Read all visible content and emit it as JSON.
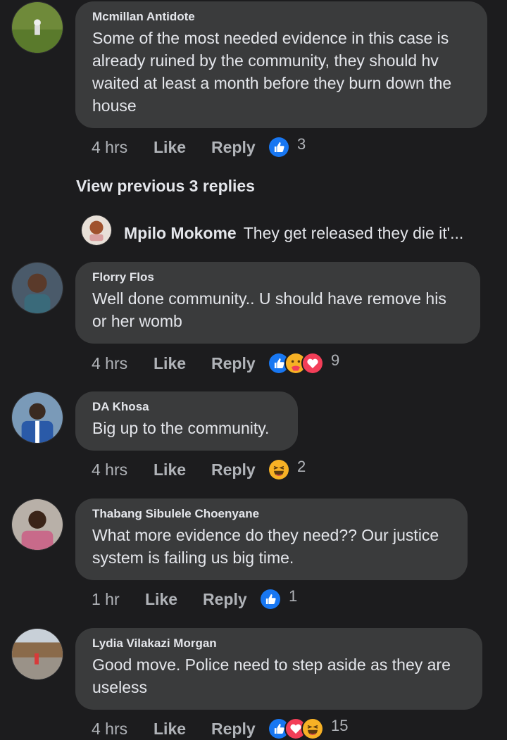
{
  "comments": [
    {
      "author": "Mcmillan Antidote",
      "text": "Some of the most needed evidence in this case is already ruined by the community, they should hv waited at least a month before they burn down the house",
      "time": "4 hrs",
      "like_label": "Like",
      "reply_label": "Reply",
      "reactions": [
        "like"
      ],
      "reaction_count": "3"
    },
    {
      "author": "Florry Flos",
      "text": "Well done community.. U should have remove his or her womb",
      "time": "4 hrs",
      "like_label": "Like",
      "reply_label": "Reply",
      "reactions": [
        "like",
        "care",
        "love"
      ],
      "reaction_count": "9"
    },
    {
      "author": "DA Khosa",
      "text": "Big up to the community.",
      "time": "4 hrs",
      "like_label": "Like",
      "reply_label": "Reply",
      "reactions": [
        "haha"
      ],
      "reaction_count": "2"
    },
    {
      "author": "Thabang Sibulele Choenyane",
      "text": "What more evidence do they need?? Our justice system is failing us big time.",
      "time": "1 hr",
      "like_label": "Like",
      "reply_label": "Reply",
      "reactions": [
        "like"
      ],
      "reaction_count": "1"
    },
    {
      "author": "Lydia Vilakazi Morgan",
      "text": "Good move. Police need to step aside as they are useless",
      "time": "4 hrs",
      "like_label": "Like",
      "reply_label": "Reply",
      "reactions": [
        "like",
        "love",
        "haha"
      ],
      "reaction_count": "15"
    }
  ],
  "view_previous_replies": "View previous 3 replies",
  "reply_preview": {
    "author": "Mpilo Mokome",
    "text": "They get released they die it'..."
  },
  "colors": {
    "background": "#1c1c1e",
    "bubble": "#3a3b3c",
    "like_blue": "#1877f2",
    "love_red": "#f33e58",
    "haha_yellow": "#f7b125"
  }
}
